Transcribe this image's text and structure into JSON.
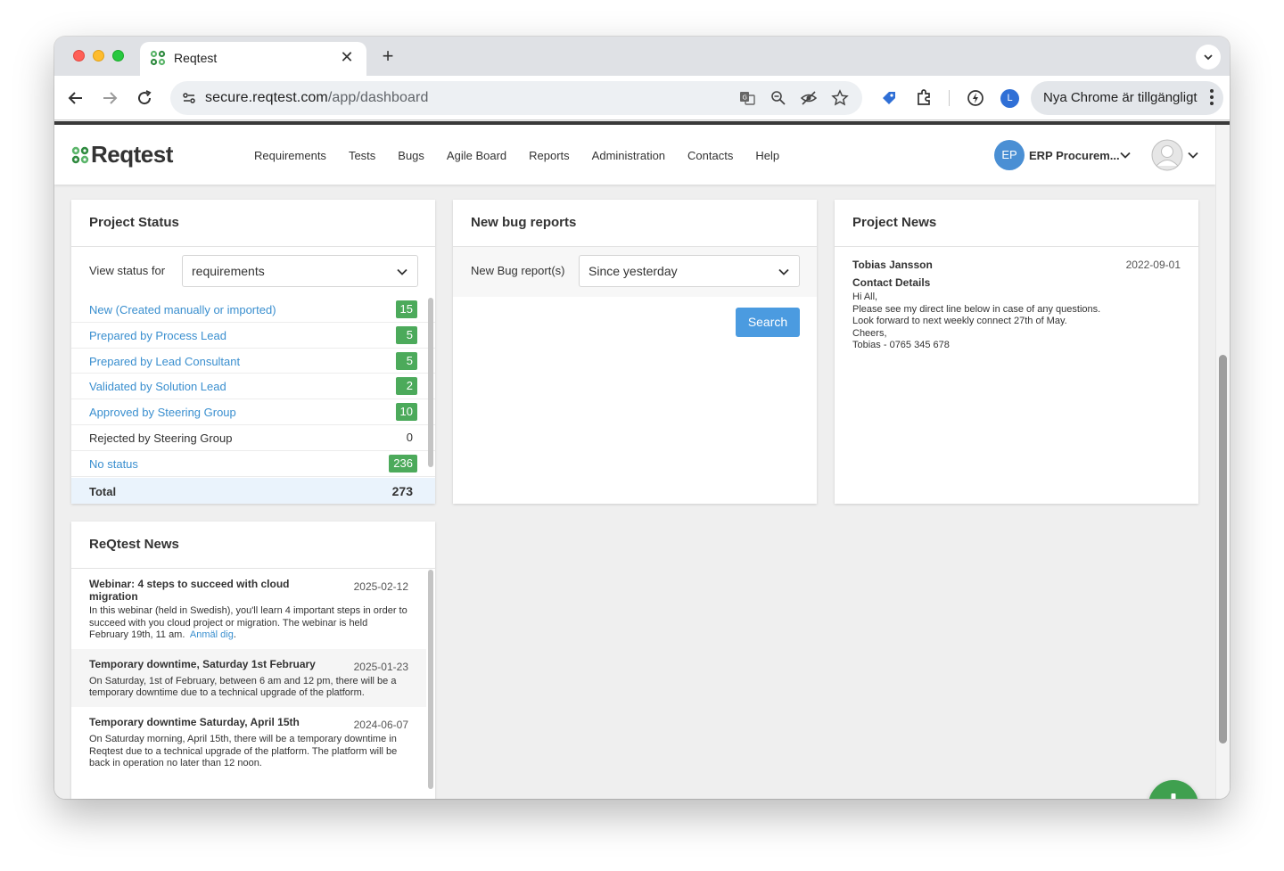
{
  "browser": {
    "tab_title": "Reqtest",
    "new_tab_symbol": "+",
    "url_host": "secure.reqtest.com",
    "url_path": "/app/dashboard",
    "profile_letter": "L",
    "update_label": "Nya Chrome är tillgängligt",
    "icons": [
      "back-icon",
      "forward-icon",
      "reload-icon",
      "site-settings-icon",
      "translate-icon",
      "zoom-icon",
      "tracking-icon",
      "bookmark-star-icon",
      "extension-tag-icon",
      "extensions-puzzle-icon",
      "performance-icon",
      "kebab-menu-icon"
    ]
  },
  "app": {
    "logo_text": "Reqtest",
    "nav": [
      "Requirements",
      "Tests",
      "Bugs",
      "Agile Board",
      "Reports",
      "Administration",
      "Contacts",
      "Help"
    ],
    "project_initials": "EP",
    "project_name": "ERP Procurem..."
  },
  "project_status": {
    "title": "Project Status",
    "filter_label": "View status for",
    "filter_value": "requirements",
    "rows": [
      {
        "label": "New (Created manually or imported)",
        "count": "15",
        "link": true
      },
      {
        "label": "Prepared by Process Lead",
        "count": "5",
        "link": true
      },
      {
        "label": "Prepared by Lead Consultant",
        "count": "5",
        "link": true
      },
      {
        "label": "Validated by Solution Lead",
        "count": "2",
        "link": true
      },
      {
        "label": "Approved by Steering Group",
        "count": "10",
        "link": true
      },
      {
        "label": "Rejected by Steering Group",
        "count": "0",
        "link": false
      },
      {
        "label": "No status",
        "count": "236",
        "link": true
      }
    ],
    "total_label": "Total",
    "total_value": "273"
  },
  "bug_reports": {
    "title": "New bug reports",
    "filter_label": "New Bug report(s)",
    "filter_value": "Since yesterday",
    "search_label": "Search"
  },
  "project_news": {
    "title": "Project News",
    "author": "Tobias Jansson",
    "date": "2022-09-01",
    "subject": "Contact Details",
    "body": "Hi All,\nPlease see my direct line below in case of any questions.\nLook forward to next weekly connect 27th of May.\nCheers,\nTobias - 0765 345 678"
  },
  "reqtest_news": {
    "title": "ReQtest News",
    "items": [
      {
        "title": "Webinar: 4 steps to succeed with cloud migration",
        "date": "2025-02-12",
        "body": "In this webinar (held in Swedish), you'll learn 4 important steps in order to succeed with you cloud project or migration. The webinar is held February 19th, 11 am.",
        "link": "Anmäl dig"
      },
      {
        "title": "Temporary downtime, Saturday 1st February",
        "date": "2025-01-23",
        "body": "On Saturday, 1st of February, between 6 am and 12 pm, there will be a temporary downtime due to a technical upgrade of the platform.",
        "link": ""
      },
      {
        "title": "Temporary downtime Saturday, April 15th",
        "date": "2024-06-07",
        "body": "On Saturday morning, April 15th, there will be a temporary downtime in Reqtest due to a technical upgrade of the platform. The platform will be back in operation no later than 12 noon.",
        "link": ""
      }
    ]
  },
  "colors": {
    "accent_green": "#4caa5b",
    "link_blue": "#3a8fcf",
    "button_blue": "#4b9be0",
    "fab_green": "#3fa04f"
  }
}
